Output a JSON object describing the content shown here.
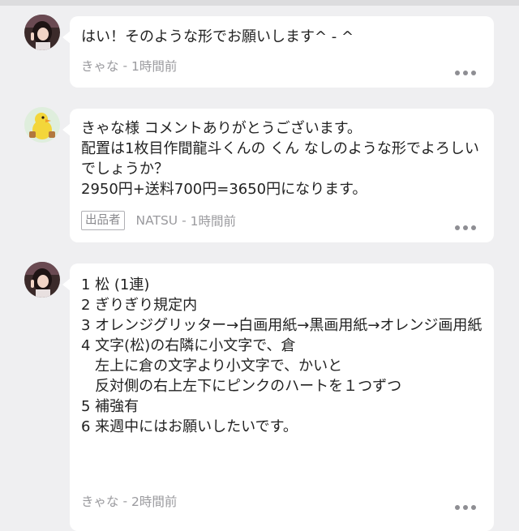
{
  "comments": [
    {
      "text": "はい！そのような形でお願いします^ - ^",
      "author": "きゃな",
      "time": "1時間前",
      "avatar_icon": "user-avatar-girl-icon"
    },
    {
      "text": "きゃな様 コメントありがとうございます。\n配置は1枚目作間龍斗くんの くん なしのような形でよろしいでしょうか？\n2950円+送料700円=3650円になります。",
      "seller_badge": "出品者",
      "author": "NATSU",
      "time": "1時間前",
      "avatar_icon": "user-avatar-duck-icon"
    },
    {
      "text": "1 松 (1連)\n2 ぎりぎり規定内\n3 オレンジグリッター→白画用紙→黒画用紙→オレンジ画用紙\n4 文字(松)の右隣に小文字で、倉\n   左上に倉の文字より小文字で、かいと\n   反対側の右上左下にピンクのハートを１つずつ\n5 補強有\n6 来週中にはお願いしたいです。",
      "author": "きゃな",
      "time": "2時間前",
      "avatar_icon": "user-avatar-girl-icon"
    }
  ],
  "separator": " - ",
  "more_icon": "more-dots-icon"
}
